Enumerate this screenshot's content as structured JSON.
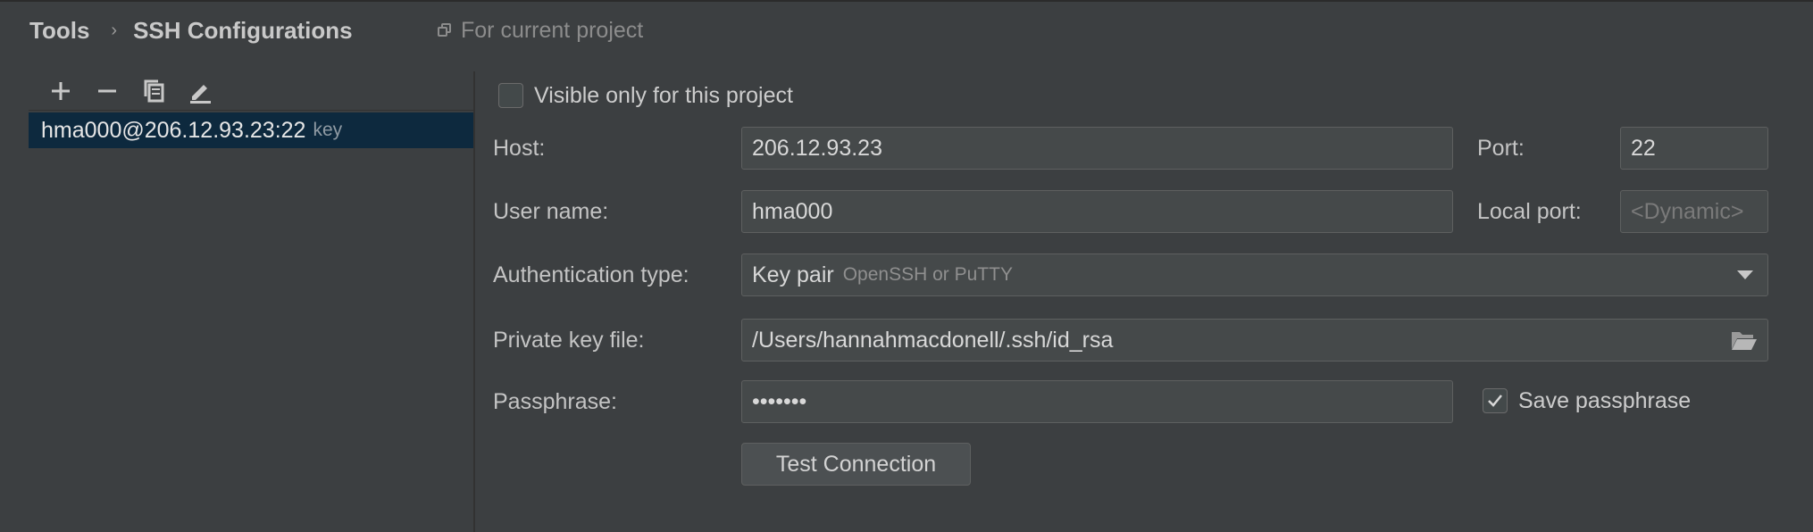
{
  "breadcrumb": {
    "parent": "Tools",
    "separator": "›",
    "current": "SSH Configurations"
  },
  "scope": {
    "label": "For current project",
    "icon": "copy-scope-icon"
  },
  "toolbar": {
    "icons": [
      "plus-icon",
      "minus-icon",
      "copy-icon",
      "edit-icon"
    ]
  },
  "configs": [
    {
      "title": "hma000@206.12.93.23:22",
      "hint": "key",
      "selected": true
    }
  ],
  "form": {
    "visible_only_label": "Visible only for this project",
    "visible_only_checked": false,
    "host_label": "Host:",
    "host_value": "206.12.93.23",
    "port_label": "Port:",
    "port_value": "22",
    "user_label": "User name:",
    "user_value": "hma000",
    "local_port_label": "Local port:",
    "local_port_placeholder": "<Dynamic>",
    "auth_label": "Authentication type:",
    "auth_value": "Key pair",
    "auth_hint": "OpenSSH or PuTTY",
    "key_label": "Private key file:",
    "key_value": "/Users/hannahmacdonell/.ssh/id_rsa",
    "passphrase_label": "Passphrase:",
    "passphrase_value": "•••••••",
    "save_passphrase_label": "Save passphrase",
    "save_passphrase_checked": true,
    "test_button": "Test Connection"
  },
  "colors": {
    "background": "#3c3f41",
    "selection": "#0d293e",
    "field_bg": "#45494a",
    "field_border": "#5e6060"
  }
}
